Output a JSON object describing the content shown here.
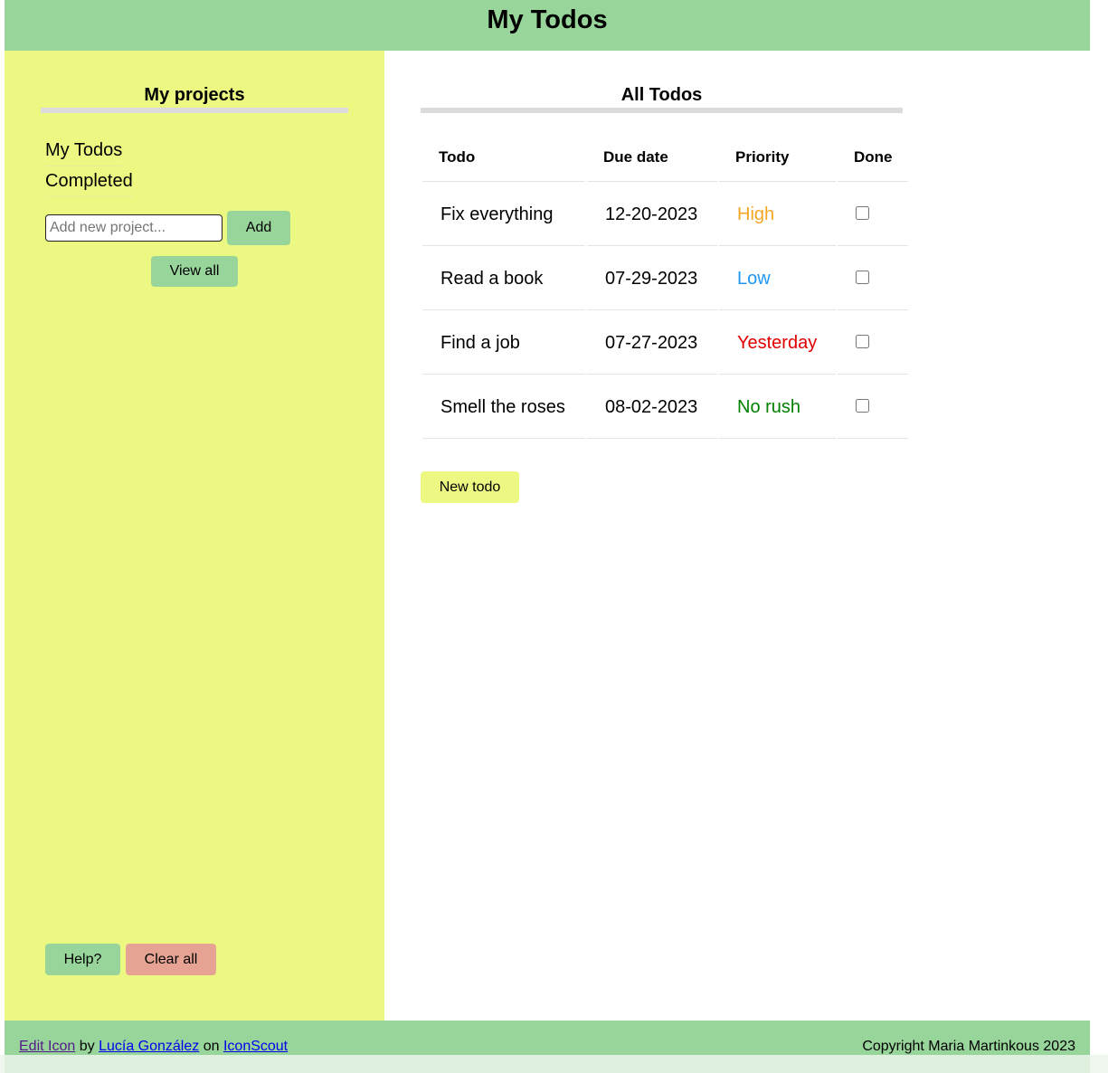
{
  "header": {
    "title": "My Todos"
  },
  "sidebar": {
    "title": "My projects",
    "projects": [
      "My Todos",
      "Completed"
    ],
    "new_project_placeholder": "Add new project...",
    "add_label": "Add",
    "view_all_label": "View all",
    "help_label": "Help?",
    "clear_all_label": "Clear all"
  },
  "main": {
    "title": "All Todos",
    "columns": [
      "Todo",
      "Due date",
      "Priority",
      "Done"
    ],
    "todos": [
      {
        "todo": "Fix everything",
        "due": "12-20-2023",
        "priority": "High",
        "priority_color": "#f5a623",
        "done": false
      },
      {
        "todo": "Read a book",
        "due": "07-29-2023",
        "priority": "Low",
        "priority_color": "#2196f3",
        "done": false
      },
      {
        "todo": "Find a job",
        "due": "07-27-2023",
        "priority": "Yesterday",
        "priority_color": "#e00000",
        "done": false
      },
      {
        "todo": "Smell the roses",
        "due": "08-02-2023",
        "priority": "No rush",
        "priority_color": "#008000",
        "done": false
      }
    ],
    "new_todo_label": "New todo"
  },
  "footer": {
    "edit_icon_link": "Edit Icon",
    "by_text": "by",
    "author_link": "Lucía González",
    "on_text": "on",
    "source_link": "IconScout",
    "copyright": "Copyright Maria Martinkous 2023"
  },
  "colors": {
    "header_bg": "#98d59b",
    "sidebar_bg": "#ecf881",
    "button_green": "#98d59b",
    "button_yellow": "#ecf881",
    "button_red": "#e6a393"
  }
}
